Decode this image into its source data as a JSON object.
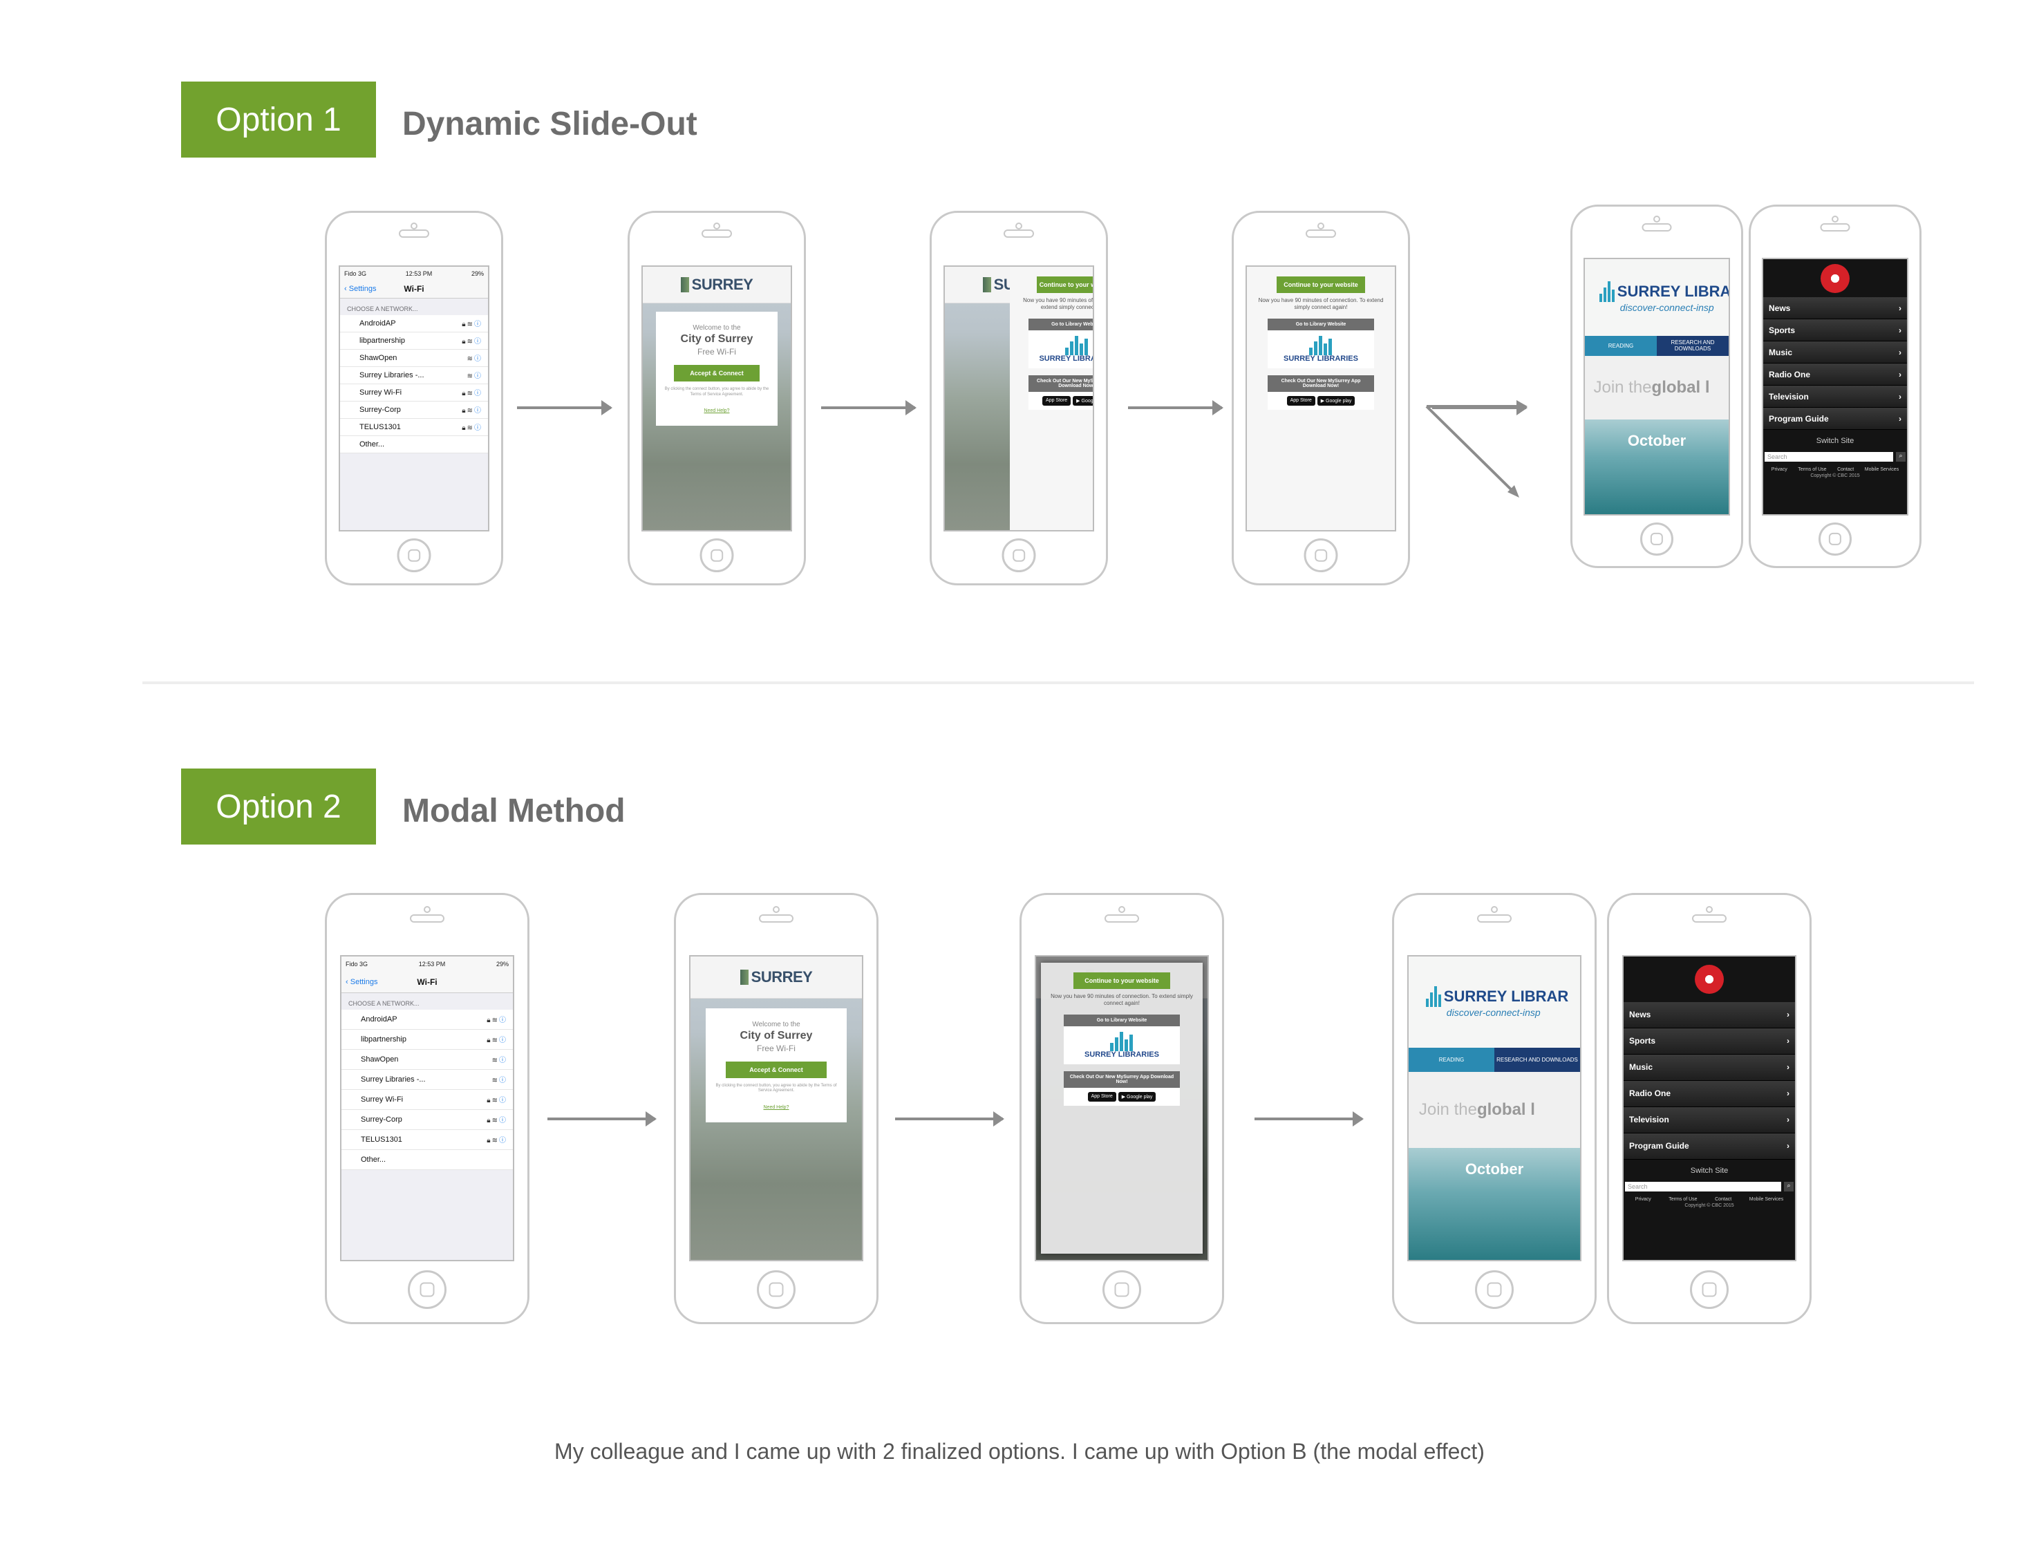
{
  "option1": {
    "badge": "Option 1",
    "title": "Dynamic Slide-Out"
  },
  "option2": {
    "badge": "Option 2",
    "title": "Modal Method"
  },
  "caption": "My colleague and I came up with 2 finalized options. I came up with Option B (the modal effect)",
  "wifi": {
    "carrier": "Fido 3G",
    "time": "12:53 PM",
    "battery": "29%",
    "back": "Settings",
    "title": "Wi-Fi",
    "section": "CHOOSE A NETWORK...",
    "networks": [
      "AndroidAP",
      "libpartnership",
      "ShawOpen",
      "Surrey Libraries -...",
      "Surrey Wi-Fi",
      "Surrey-Corp",
      "TELUS1301",
      "Other..."
    ]
  },
  "portal": {
    "brand": "SURREY",
    "welcome": "Welcome to the",
    "city": "City of Surrey",
    "free": "Free Wi-Fi",
    "accept": "Accept & Connect",
    "terms": "By clicking the connect button, you agree to abide by the Terms of Service Agreement.",
    "help": "Need Help?"
  },
  "panel": {
    "continue": "Continue to your website",
    "msg": "Now you have 90 minutes of connection. To extend simply connect again!",
    "library_heading": "Go to Library Website",
    "library_name": "SURREY LIBRARIES",
    "app_heading": "Check Out Our New MySurrey App Download Now!",
    "appstore": "App Store",
    "googleplay": "Google play"
  },
  "library": {
    "title": "SURREY LIBRAR",
    "tagline": "discover-connect-insp",
    "tab1": "READING",
    "tab2": "RESEARCH AND DOWNLOADS",
    "join_light": "Join the ",
    "join_bold": "global l",
    "month": "October"
  },
  "cbc": {
    "menu": [
      "News",
      "Sports",
      "Music",
      "Radio One",
      "Television",
      "Program Guide"
    ],
    "switch": "Switch Site",
    "search": "Search",
    "footer": [
      "Privacy",
      "Terms of Use",
      "Contact",
      "Mobile Services"
    ],
    "copyright": "Copyright © CBC 2015"
  }
}
